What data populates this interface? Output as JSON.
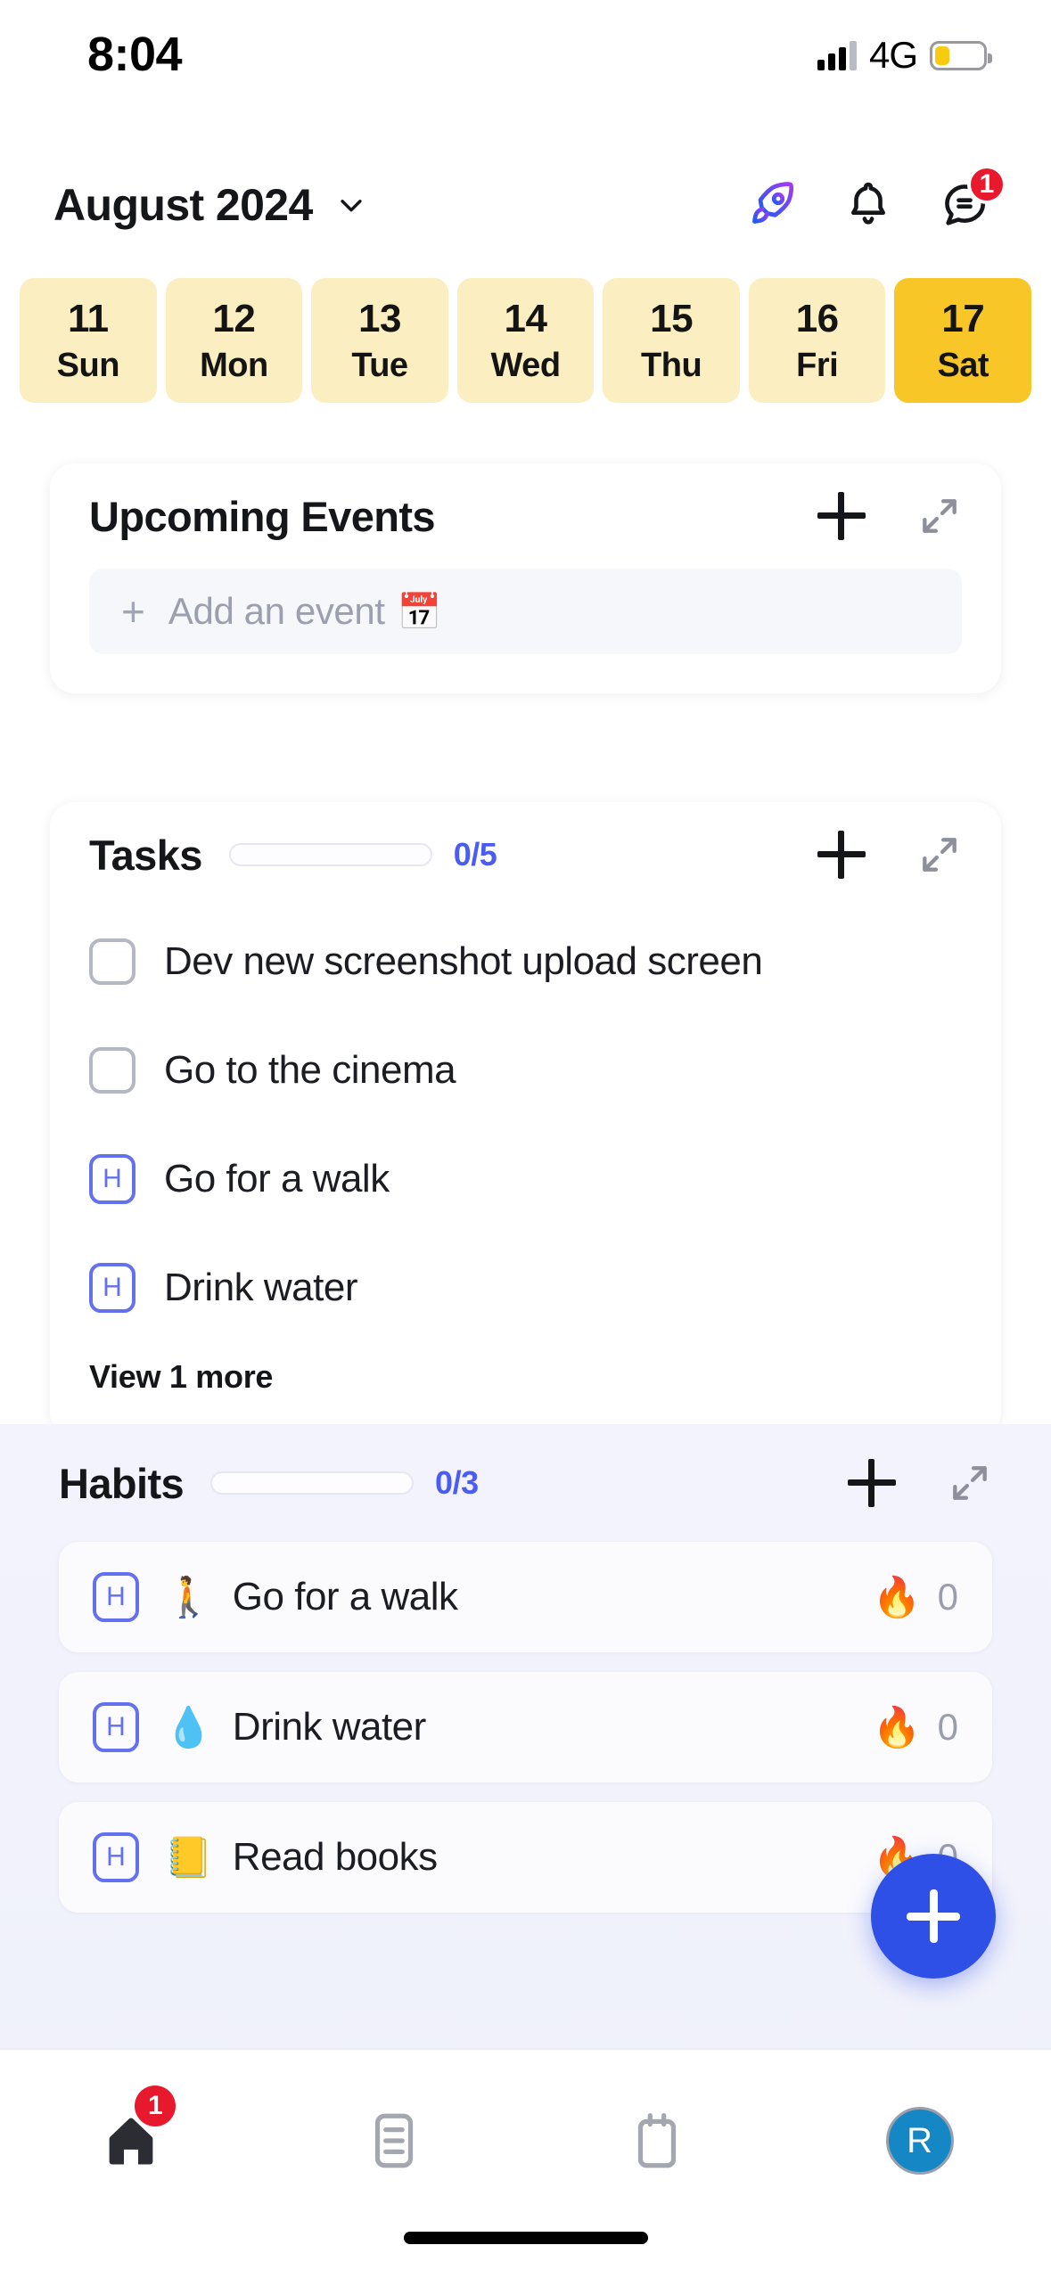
{
  "status_bar": {
    "time": "8:04",
    "network": "4G",
    "signal_icon": "signal-bars-icon",
    "battery_icon": "battery-low-icon"
  },
  "header": {
    "month_label": "August 2024",
    "chevron_icon": "chevron-down-icon",
    "rocket_icon": "rocket-icon",
    "bell_icon": "bell-icon",
    "chat_icon": "chat-bubble-icon",
    "chat_badge": "1"
  },
  "date_strip": {
    "days": [
      {
        "num": "11",
        "name": "Sun",
        "selected": false
      },
      {
        "num": "12",
        "name": "Mon",
        "selected": false
      },
      {
        "num": "13",
        "name": "Tue",
        "selected": false
      },
      {
        "num": "14",
        "name": "Wed",
        "selected": false
      },
      {
        "num": "15",
        "name": "Thu",
        "selected": false
      },
      {
        "num": "16",
        "name": "Fri",
        "selected": false
      },
      {
        "num": "17",
        "name": "Sat",
        "selected": true
      }
    ],
    "colors": {
      "cell": "#FBEEC0",
      "selected": "#F8C627"
    }
  },
  "events_card": {
    "title": "Upcoming Events",
    "add_icon": "plus-icon",
    "expand_icon": "expand-diagonal-icon",
    "add_row": {
      "plus": "+",
      "text": "Add an event",
      "emoji": "📅"
    }
  },
  "tasks_card": {
    "title": "Tasks",
    "progress_label": "0/5",
    "progress_value": 0,
    "progress_total": 5,
    "add_icon": "plus-icon",
    "collapse_icon": "collapse-diagonal-icon",
    "items": [
      {
        "label": "Dev new screenshot upload screen",
        "type": "checkbox",
        "checked": false
      },
      {
        "label": "Go to the cinema",
        "type": "checkbox",
        "checked": false
      },
      {
        "label": "Go for a walk",
        "type": "habit",
        "badge": "H"
      },
      {
        "label": "Drink water",
        "type": "habit",
        "badge": "H"
      }
    ],
    "view_more": "View 1 more"
  },
  "habits_card": {
    "title": "Habits",
    "progress_label": "0/3",
    "progress_value": 0,
    "progress_total": 3,
    "add_icon": "plus-icon",
    "expand_icon": "expand-diagonal-icon",
    "items": [
      {
        "badge": "H",
        "emoji": "🚶",
        "label": "Go for a walk",
        "streak_emoji": "🔥",
        "streak": "0"
      },
      {
        "badge": "H",
        "emoji": "💧",
        "label": "Drink water",
        "streak_emoji": "🔥",
        "streak": "0"
      },
      {
        "badge": "H",
        "emoji": "📒",
        "label": "Read books",
        "streak_emoji": "🔥",
        "streak": "0"
      }
    ]
  },
  "fab": {
    "icon": "plus-icon",
    "color": "#2F50E6"
  },
  "bottom_nav": {
    "items": [
      {
        "icon": "home-icon",
        "badge": "1",
        "active": true
      },
      {
        "icon": "list-icon",
        "badge": "",
        "active": false
      },
      {
        "icon": "calendar-icon",
        "badge": "",
        "active": false
      },
      {
        "icon": "avatar-icon",
        "badge": "",
        "active": false,
        "initial": "R"
      }
    ]
  },
  "accent_colors": {
    "indigo": "#4A5CF2",
    "badge_red": "#E8192C",
    "habit_purple": "#6370F0",
    "avatar_blue": "#1487C4"
  }
}
